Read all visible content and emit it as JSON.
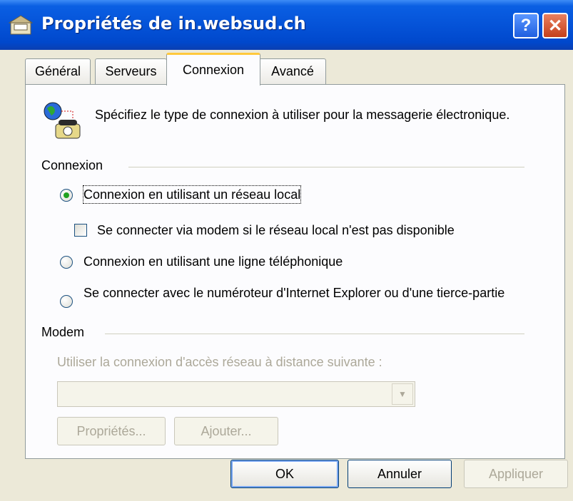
{
  "window": {
    "title": "Propriétés de in.websud.ch",
    "help_label": "?",
    "close_label": "✕"
  },
  "tabs": [
    {
      "label": "Général",
      "active": false
    },
    {
      "label": "Serveurs",
      "active": false
    },
    {
      "label": "Connexion",
      "active": true
    },
    {
      "label": "Avancé",
      "active": false
    }
  ],
  "intro_text": "Spécifiez le type de connexion à utiliser pour la messagerie électronique.",
  "connexion_group": {
    "label": "Connexion",
    "options": [
      {
        "label": "Connexion en utilisant un réseau local",
        "checked": true
      },
      {
        "label": "Connexion en utilisant une ligne téléphonique",
        "checked": false
      },
      {
        "label": "Se connecter avec le numéroteur d'Internet Explorer ou d'une tierce-partie",
        "checked": false
      }
    ],
    "modem_checkbox": {
      "label": "Se connecter via modem si le réseau local n'est pas disponible",
      "checked": false
    }
  },
  "modem_group": {
    "label": "Modem",
    "prompt": "Utiliser la connexion d'accès réseau à distance suivante :",
    "select_value": "",
    "properties_label": "Propriétés...",
    "add_label": "Ajouter..."
  },
  "footer": {
    "ok_label": "OK",
    "cancel_label": "Annuler",
    "apply_label": "Appliquer"
  },
  "colors": {
    "titlebar": "#0553d8",
    "active_tab_accent": "#ffc83c",
    "radio_dot": "#21a121"
  }
}
